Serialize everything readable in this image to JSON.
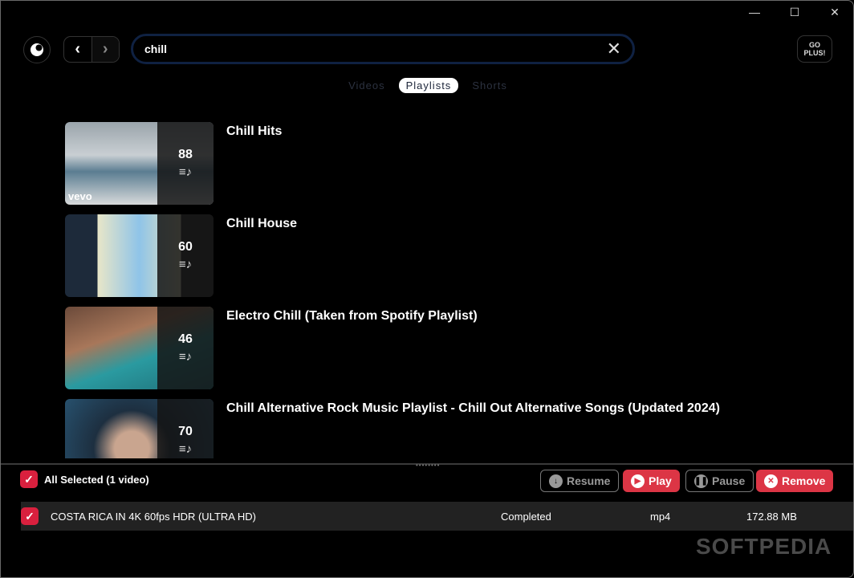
{
  "window": {
    "minimize": "—",
    "maximize": "☐",
    "close": "✕"
  },
  "search": {
    "value": "chill"
  },
  "go_plus": "GO PLUS!",
  "tabs": [
    {
      "label": "Videos"
    },
    {
      "label": "Playlists",
      "active": true
    },
    {
      "label": "Shorts"
    }
  ],
  "playlists": [
    {
      "title": "Chill Hits",
      "count": "88",
      "badge": "vevo"
    },
    {
      "title": "Chill House",
      "count": "60"
    },
    {
      "title": "Electro Chill (Taken from Spotify Playlist)",
      "count": "46"
    },
    {
      "title": "Chill Alternative Rock Music Playlist - Chill Out Alternative Songs (Updated 2024)",
      "count": "70"
    }
  ],
  "downloads": {
    "all_selected": "All Selected (1 video)",
    "buttons": {
      "resume": "Resume",
      "play": "Play",
      "pause": "Pause",
      "remove": "Remove"
    },
    "rows": [
      {
        "title": "COSTA RICA IN 4K 60fps HDR (ULTRA HD)",
        "status": "Completed",
        "format": "mp4",
        "size": "172.88 MB"
      }
    ]
  },
  "watermark": "SOFTPEDIA",
  "colors": {
    "accent": "#dc3545",
    "search_border": "#0f2142"
  }
}
